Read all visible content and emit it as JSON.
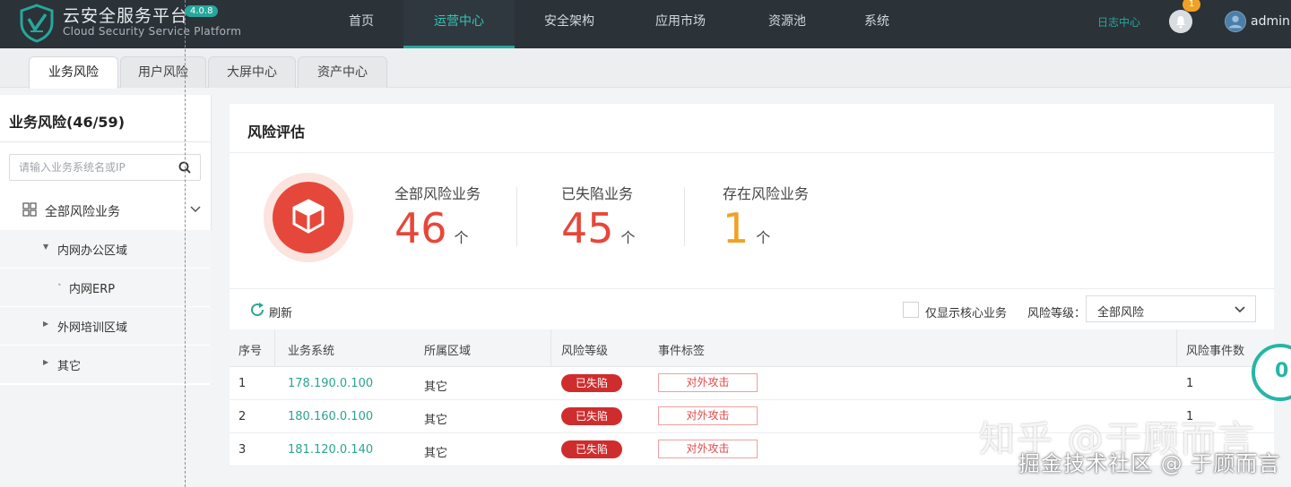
{
  "app": {
    "name_cn": "云安全服务平台",
    "version": "4.0.8",
    "name_en": "Cloud Security Service Platform"
  },
  "nav": {
    "items": [
      {
        "label": "首页"
      },
      {
        "label": "运营中心",
        "active": true
      },
      {
        "label": "安全架构"
      },
      {
        "label": "应用市场"
      },
      {
        "label": "资源池"
      },
      {
        "label": "系统"
      }
    ],
    "log_center": "日志中心",
    "notification_count": "1",
    "user": "admin"
  },
  "tabs": [
    {
      "label": "业务风险",
      "active": true
    },
    {
      "label": "用户风险"
    },
    {
      "label": "大屏中心"
    },
    {
      "label": "资产中心"
    }
  ],
  "sidebar": {
    "title": "业务风险(46/59)",
    "search_placeholder": "请输入业务系统名或IP",
    "root_label": "全部风险业务",
    "items": [
      {
        "label": "内网办公区域",
        "expanded": true
      },
      {
        "label": "内网ERP"
      },
      {
        "label": "外网培训区域"
      },
      {
        "label": "其它"
      }
    ]
  },
  "panel": {
    "title": "风险评估",
    "stats": [
      {
        "label": "全部风险业务",
        "value": "46",
        "unit": "个",
        "color": "#e5483a"
      },
      {
        "label": "已失陷业务",
        "value": "45",
        "unit": "个",
        "color": "#e5483a"
      },
      {
        "label": "存在风险业务",
        "value": "1",
        "unit": "个",
        "color": "#f0a124"
      }
    ],
    "toolbar": {
      "refresh": "刷新",
      "core_only": "仅显示核心业务",
      "level_label": "风险等级：",
      "level_value": "全部风险"
    },
    "table": {
      "headers": [
        "序号",
        "业务系统",
        "所属区域",
        "风险等级",
        "事件标签",
        "风险事件数"
      ],
      "rows": [
        {
          "no": "1",
          "system": "178.190.0.100",
          "region": "其它",
          "level": "已失陷",
          "tag": "对外攻击",
          "count": "1"
        },
        {
          "no": "2",
          "system": "180.160.0.100",
          "region": "其它",
          "level": "已失陷",
          "tag": "对外攻击",
          "count": "1"
        },
        {
          "no": "3",
          "system": "181.120.0.140",
          "region": "其它",
          "level": "已失陷",
          "tag": "对外攻击",
          "count": ""
        }
      ]
    }
  },
  "float_button_value": "0",
  "watermark": {
    "line1": "知乎 @于顾而言",
    "line2": "掘金技术社区 @ 于顾而言"
  }
}
